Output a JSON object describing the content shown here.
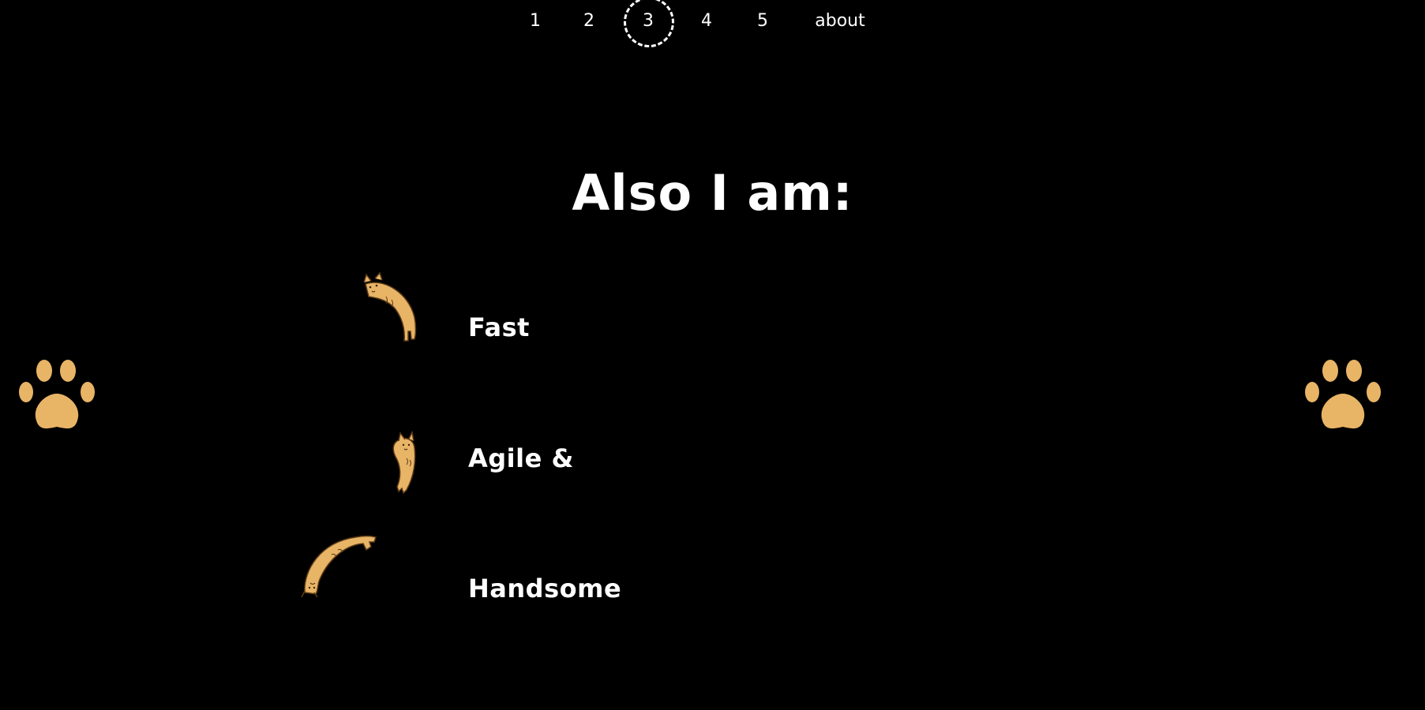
{
  "nav": {
    "items": [
      {
        "label": "1"
      },
      {
        "label": "2"
      },
      {
        "label": "3",
        "active": true
      },
      {
        "label": "4"
      },
      {
        "label": "5"
      },
      {
        "label": "about"
      }
    ]
  },
  "heading": "Also I am:",
  "traits": [
    {
      "label": "Fast",
      "icon": "curled-cat-icon"
    },
    {
      "label": "Agile &",
      "icon": "hanging-cat-icon"
    },
    {
      "label": "Handsome",
      "icon": "arched-cat-icon"
    }
  ],
  "decor": {
    "left_icon": "paw-print-icon",
    "right_icon": "paw-print-icon"
  },
  "colors": {
    "background": "#000000",
    "text": "#ffffff",
    "cat_fill": "#e8b466",
    "cat_outline": "#5a3a16",
    "paw": "#e8b466"
  }
}
